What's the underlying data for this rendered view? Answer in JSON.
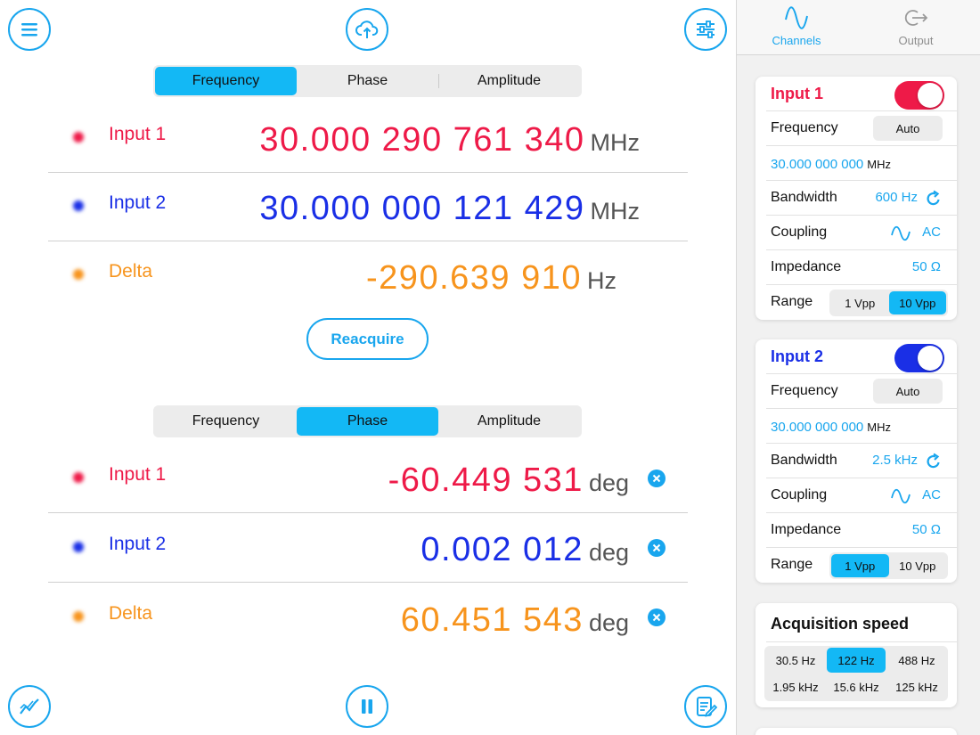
{
  "colors": {
    "accent": "#19a6ee",
    "selected": "#13b8f5",
    "input1": "#ee1a48",
    "input2": "#1a2fe6",
    "delta": "#f7941d"
  },
  "toolbar": {
    "menu_icon": "hamburger-menu-icon",
    "upload_icon": "cloud-upload-icon",
    "settings_icon": "sliders-icon",
    "chart_icon": "trend-chart-icon",
    "pause_icon": "pause-icon",
    "notes_icon": "edit-note-icon"
  },
  "top_panel": {
    "tabs": [
      "Frequency",
      "Phase",
      "Amplitude"
    ],
    "selected_tab": "Frequency",
    "rows": [
      {
        "label": "Input 1",
        "value": "30.000 290 761 340",
        "unit": "MHz"
      },
      {
        "label": "Input 2",
        "value": "30.000 000 121 429",
        "unit": "MHz"
      },
      {
        "label": "Delta",
        "value": "-290.639 910",
        "unit": "Hz"
      }
    ],
    "reacquire_label": "Reacquire"
  },
  "bottom_panel": {
    "tabs": [
      "Frequency",
      "Phase",
      "Amplitude"
    ],
    "selected_tab": "Phase",
    "rows": [
      {
        "label": "Input 1",
        "value": "-60.449 531",
        "unit": "deg"
      },
      {
        "label": "Input 2",
        "value": "0.002 012",
        "unit": "deg"
      },
      {
        "label": "Delta",
        "value": "60.451 543",
        "unit": "deg"
      }
    ]
  },
  "sidebar": {
    "tabs": [
      {
        "label": "Channels",
        "icon": "waveform-icon",
        "active": true
      },
      {
        "label": "Output",
        "icon": "output-arrow-icon",
        "active": false
      }
    ],
    "input1": {
      "title": "Input 1",
      "enabled": true,
      "frequency_label": "Frequency",
      "auto_label": "Auto",
      "frequency_value": "30.000 000 000",
      "frequency_unit": "MHz",
      "bandwidth_label": "Bandwidth",
      "bandwidth_value": "600 Hz",
      "coupling_label": "Coupling",
      "coupling_value": "AC",
      "impedance_label": "Impedance",
      "impedance_value": "50 Ω",
      "range_label": "Range",
      "range_options": [
        "1 Vpp",
        "10 Vpp"
      ],
      "range_selected": "10 Vpp"
    },
    "input2": {
      "title": "Input 2",
      "enabled": true,
      "frequency_label": "Frequency",
      "auto_label": "Auto",
      "frequency_value": "30.000 000 000",
      "frequency_unit": "MHz",
      "bandwidth_label": "Bandwidth",
      "bandwidth_value": "2.5 kHz",
      "coupling_label": "Coupling",
      "coupling_value": "AC",
      "impedance_label": "Impedance",
      "impedance_value": "50 Ω",
      "range_label": "Range",
      "range_options": [
        "1 Vpp",
        "10 Vpp"
      ],
      "range_selected": "1 Vpp"
    },
    "acquisition": {
      "title": "Acquisition speed",
      "options": [
        "30.5 Hz",
        "122 Hz",
        "488 Hz",
        "1.95 kHz",
        "15.6 kHz",
        "125 kHz"
      ],
      "selected": "122 Hz"
    }
  }
}
